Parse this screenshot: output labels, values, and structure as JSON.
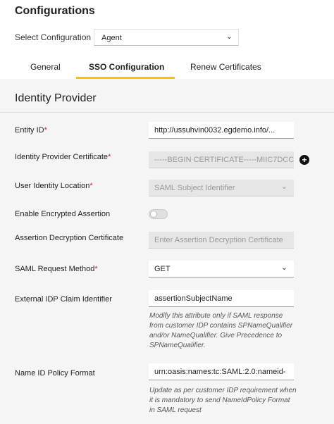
{
  "header": {
    "title": "Configurations"
  },
  "config_select": {
    "label": "Select Configuration",
    "value": "Agent"
  },
  "tabs": [
    {
      "label": "General",
      "active": false
    },
    {
      "label": "SSO Configuration",
      "active": true
    },
    {
      "label": "Renew Certificates",
      "active": false
    }
  ],
  "accent_color": "#f5c400",
  "section": {
    "title": "Identity Provider"
  },
  "fields": {
    "entity_id": {
      "label": "Entity ID",
      "required": "*",
      "value": "http://ussuhvin0032.egdemo.info/..."
    },
    "idp_certificate": {
      "label": "Identity Provider Certificate",
      "required": "*",
      "value": "-----BEGIN CERTIFICATE-----MIIC7DCCA"
    },
    "user_identity_location": {
      "label": "User Identity Location",
      "required": "*",
      "value": "SAML Subject Identifier"
    },
    "enable_encrypted_assertion": {
      "label": "Enable Encrypted Assertion",
      "enabled": false
    },
    "assertion_decryption_certificate": {
      "label": "Assertion Decryption Certificate",
      "placeholder": "Enter Assertion Decryption Certificate"
    },
    "saml_request_method": {
      "label": "SAML Request Method",
      "required": "*",
      "value": "GET"
    },
    "external_idp_claim_identifier": {
      "label": "External IDP Claim Identifier",
      "value": "assertionSubjectName",
      "helper": "Modify this attribute only if SAML response from customer IDP contains SPNameQualifier and/or NameQualifier. Give Precedence to SPNameQualifier."
    },
    "name_id_policy_format": {
      "label": "Name ID Policy Format",
      "value": "urn:oasis:names:tc:SAML:2.0:nameid-",
      "helper": "Update as per customer IDP requirement when it is mandatory to send NameIdPolicy Format in SAML request"
    }
  },
  "icons": {
    "chevron": "chevron-down-icon",
    "add": "plus-circle-icon"
  }
}
